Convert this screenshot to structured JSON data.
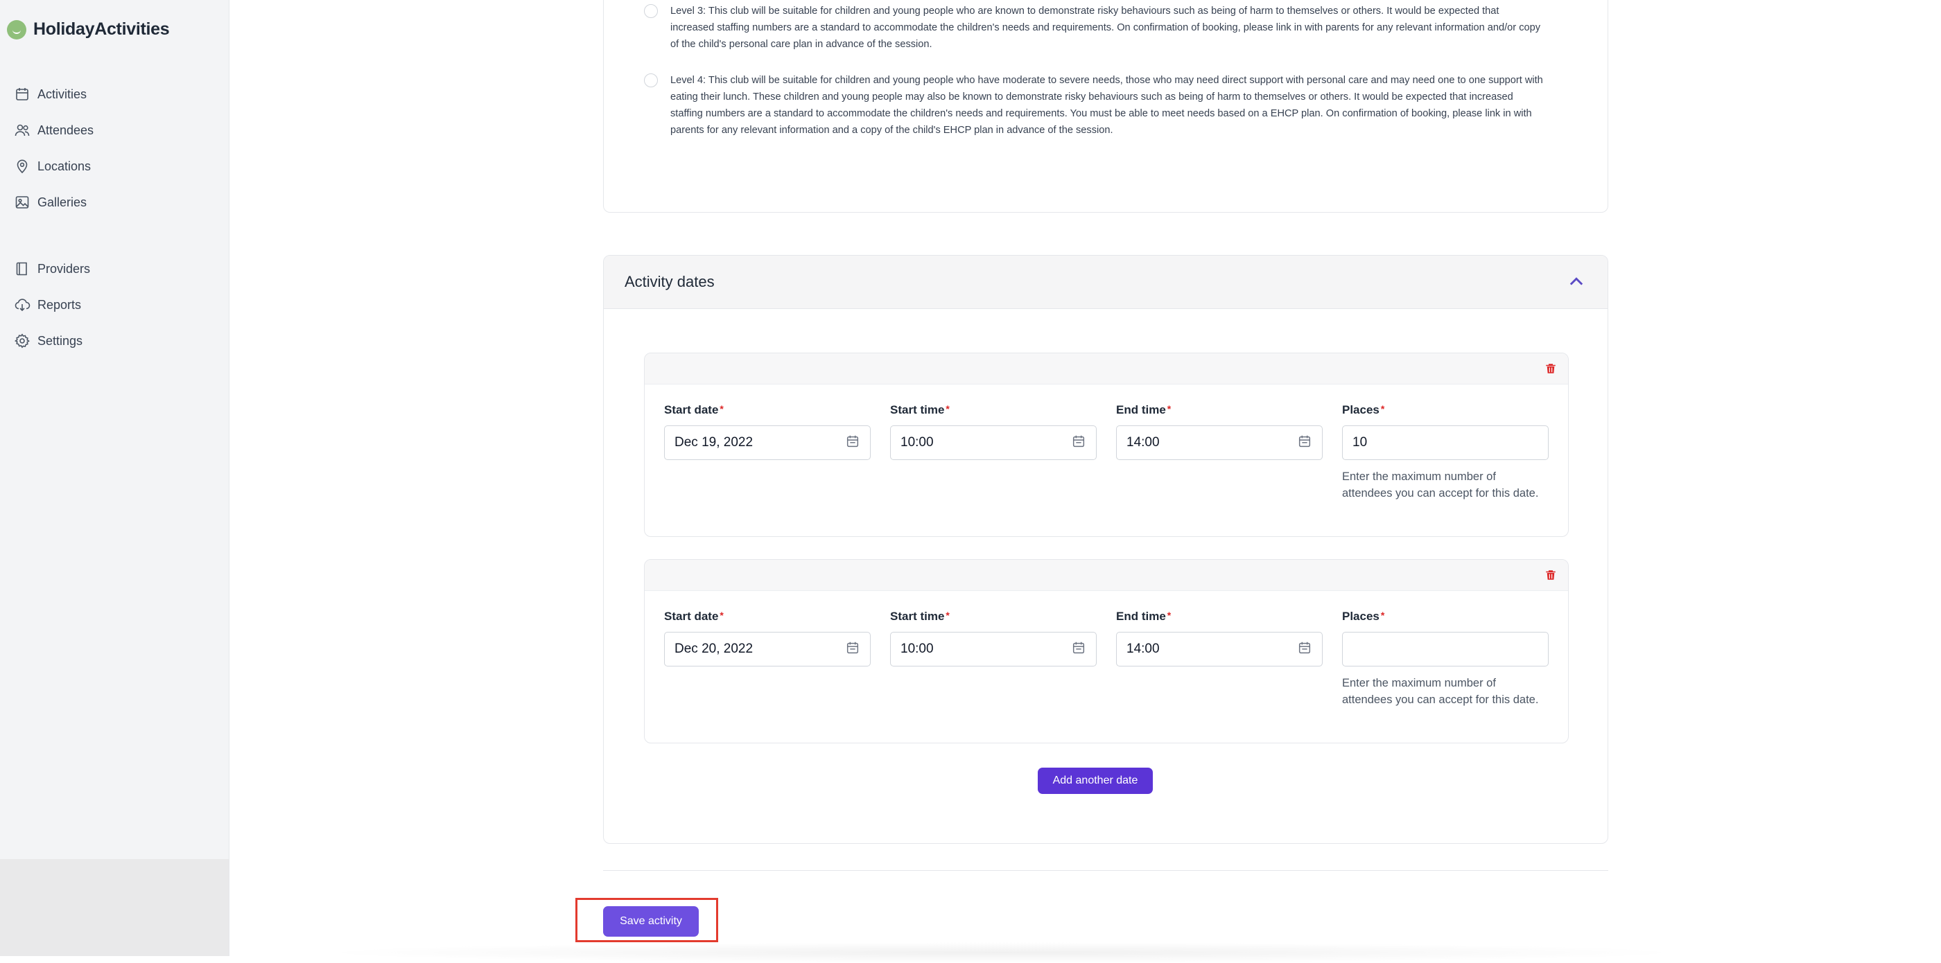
{
  "brand": {
    "name": "HolidayActivities"
  },
  "sidebar": {
    "items": [
      {
        "label": "Activities",
        "icon": "calendar-icon"
      },
      {
        "label": "Attendees",
        "icon": "users-icon"
      },
      {
        "label": "Locations",
        "icon": "map-pin-icon"
      },
      {
        "label": "Galleries",
        "icon": "image-icon"
      },
      {
        "label": "Providers",
        "icon": "book-icon"
      },
      {
        "label": "Reports",
        "icon": "cloud-download-icon"
      },
      {
        "label": "Settings",
        "icon": "gear-icon"
      }
    ]
  },
  "support_levels": [
    {
      "text": "Level 3: This club will be suitable for children and young people who are known to demonstrate risky behaviours such as being of harm to themselves or others. It would be expected that increased staffing numbers are a standard to accommodate the children's needs and requirements. On confirmation of booking, please link in with parents for any relevant information and/or copy of the child's personal care plan in advance of the session."
    },
    {
      "text": "Level 4: This club will be suitable for children and young people who have moderate to severe needs, those who may need direct support with personal care and may need one to one support with eating their lunch. These children and young people may also be known to demonstrate risky behaviours such as being of harm to themselves or others. It would be expected that increased staffing numbers are a standard to accommodate the children's needs and requirements. You must be able to meet needs based on a EHCP plan. On confirmation of booking, please link in with parents for any relevant information and a copy of the child's EHCP plan in advance of the session."
    }
  ],
  "activity_dates": {
    "title": "Activity dates",
    "labels": {
      "start_date": "Start date",
      "start_time": "Start time",
      "end_time": "End time",
      "places": "Places",
      "required_marker": "*",
      "places_help": "Enter the maximum number of attendees you can accept for this date."
    },
    "dates": [
      {
        "start_date": "Dec 19, 2022",
        "start_time": "10:00",
        "end_time": "14:00",
        "places": "10"
      },
      {
        "start_date": "Dec 20, 2022",
        "start_time": "10:00",
        "end_time": "14:00",
        "places": ""
      }
    ],
    "add_label": "Add another date"
  },
  "footer": {
    "save_label": "Save activity"
  },
  "colors": {
    "primary": "#5b34d6",
    "save": "#6d4fe0",
    "highlight": "#e33b2e",
    "danger": "#dc2626"
  }
}
